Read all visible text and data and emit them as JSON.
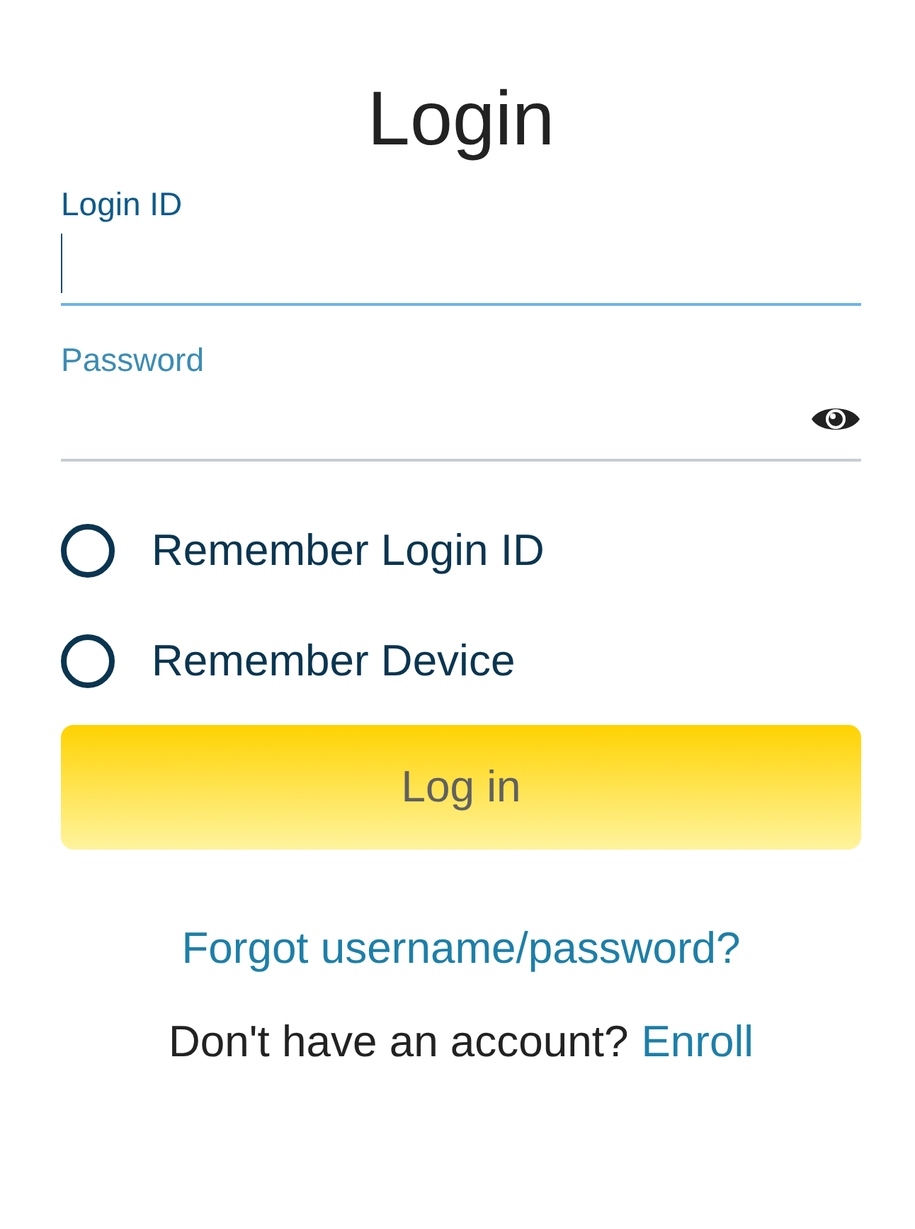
{
  "title": "Login",
  "fields": [
    {
      "label": "Login ID",
      "kind": "text",
      "focused": true
    },
    {
      "label": "Password",
      "kind": "password",
      "focused": false
    }
  ],
  "options": [
    {
      "label": "Remember Login ID",
      "checked": false
    },
    {
      "label": "Remember Device",
      "checked": false
    }
  ],
  "submit": "Log in",
  "forgot_link": "Forgot username/password?",
  "enroll": {
    "text": "Don't have an account?",
    "link": "Enroll"
  }
}
